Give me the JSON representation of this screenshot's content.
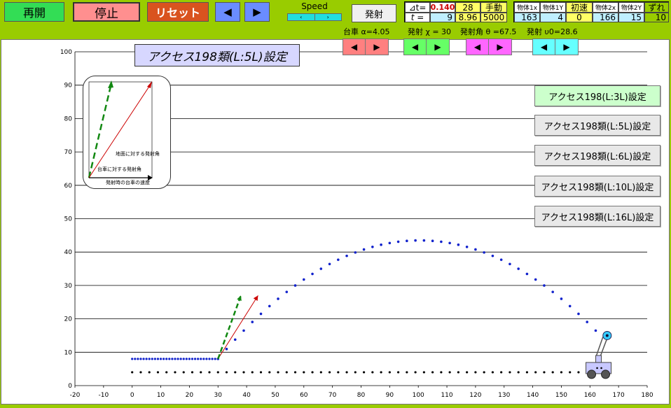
{
  "toolbar": {
    "resume_label": "再開",
    "stop_label": "停止",
    "reset_label": "リセット",
    "prev_icon": "◀",
    "next_icon": "▶",
    "speed_label": "Speed",
    "speed_left": "‹",
    "speed_right": "›",
    "fire_label": "発射"
  },
  "time_panel": {
    "dt_label": "⊿t=",
    "dt_value": "0.140",
    "step_value": "28",
    "mode_label": "手動",
    "t_label": "t =",
    "t_index": "9",
    "t_value": "8.96",
    "t_max": "5000"
  },
  "objects_panel": {
    "obj1x_label": "物体1x",
    "obj1y_label": "物体1Y",
    "init_vel_label": "初速",
    "obj2x_label": "物体2x",
    "obj2y_label": "物体2Y",
    "offset_label": "ずれ",
    "obj1x_value": "163",
    "obj1y_value": "4",
    "init_vel_value": "0",
    "obj2x_value": "166",
    "obj2y_value": "15",
    "offset_value": "10"
  },
  "params": {
    "cart_alpha": "台車 α=4.05",
    "fire_chi": "発射 χ = 30",
    "fire_angle": "発射角 θ =67.5",
    "fire_v0": "発射 υ0=28.6"
  },
  "title_box": "アクセス198類(L:5L)設定",
  "presets": [
    "アクセス198(L:3L)設定",
    "アクセス198類(L:5L)設定",
    "アクセス198類(L:6L)設定",
    "アクセス198類(L:10L)設定",
    "アクセス198類(L:16L)設定"
  ],
  "inset": {
    "label_ground": "地面に対する発射角",
    "label_cart": "台車に対する発射角",
    "label_speed": "発射時の台車の速度"
  },
  "colors": {
    "red_pair": "#ff8080",
    "green_pair": "#66ff66",
    "magenta_pair": "#ff66ff",
    "cyan_pair": "#66ffff"
  },
  "chart_data": {
    "type": "scatter",
    "xlim": [
      -20,
      180
    ],
    "ylim": [
      0,
      100
    ],
    "x_ticks": [
      -20,
      -10,
      0,
      10,
      20,
      30,
      40,
      50,
      60,
      70,
      80,
      90,
      100,
      110,
      120,
      130,
      140,
      150,
      160,
      170,
      180
    ],
    "y_ticks": [
      0,
      10,
      20,
      30,
      40,
      50,
      60,
      70,
      80,
      90,
      100
    ],
    "grid": "horizontal",
    "series": [
      {
        "color": "#000000",
        "y_const": 4,
        "x_start": 0,
        "x_end": 160,
        "x_step": 3
      },
      {
        "color": "#1122cc",
        "y_const": 8,
        "x_start": 0,
        "x_end": 30,
        "x_step": 1
      },
      {
        "color": "#1122cc",
        "parabola": {
          "x0": 30,
          "y0": 8,
          "x_vertex": 100.5,
          "y_vertex": 43.5,
          "x_end": 163,
          "x_step": 3
        }
      }
    ],
    "vectors": [
      {
        "color": "#cc0000",
        "from": [
          30,
          8
        ],
        "to": [
          44,
          27
        ],
        "dashed": false
      },
      {
        "color": "#118811",
        "from": [
          30,
          8
        ],
        "to": [
          38,
          27
        ],
        "dashed": true
      }
    ],
    "cart": {
      "x": 163,
      "y": 4,
      "ball": [
        166,
        15
      ]
    }
  }
}
